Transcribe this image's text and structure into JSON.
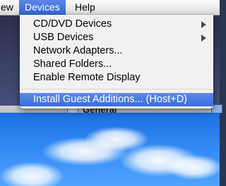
{
  "menubar": {
    "items": [
      {
        "label": "ew"
      },
      {
        "label": "Devices"
      },
      {
        "label": "Help"
      }
    ]
  },
  "devices_menu": {
    "items": [
      {
        "label": "CD/DVD Devices",
        "submenu": true
      },
      {
        "label": "USB Devices",
        "submenu": true
      },
      {
        "label": "Network Adapters..."
      },
      {
        "label": "Shared Folders..."
      },
      {
        "label": "Enable Remote Display"
      },
      {
        "label": "Install Guest Additions... (Host+D)",
        "highlighted": true
      }
    ]
  },
  "vm_window": {
    "section_label": "General"
  },
  "colors": {
    "highlight": "#3a6cdc",
    "close": "#e0443e",
    "minimize": "#e2a829",
    "zoom": "#58b43d"
  }
}
